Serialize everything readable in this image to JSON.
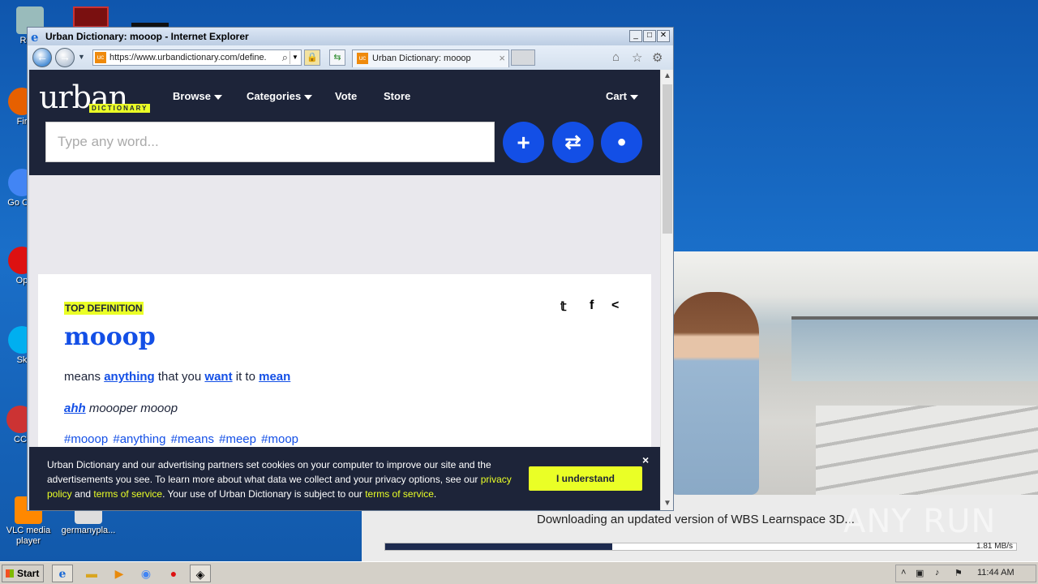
{
  "desktop": {
    "icons": [
      {
        "label": "Recy",
        "color": "#8aa"
      },
      {
        "label": "Fir",
        "color": "#e66000"
      },
      {
        "label": "Go\nChr",
        "color": "#4285f4"
      },
      {
        "label": "Op",
        "color": "#d11"
      },
      {
        "label": "Sk",
        "color": "#00aff0"
      },
      {
        "label": "CC",
        "color": "#c33"
      },
      {
        "label": "VLC media player",
        "color": "#f80"
      },
      {
        "label": "germanypla...",
        "color": "#ddd"
      }
    ]
  },
  "background_app": {
    "download_text": "Downloading an updated version of WBS Learnspace 3D...",
    "download_progress": 0.36,
    "speed": "1.81 MB/s",
    "watermark": "ANY RUN"
  },
  "browser": {
    "title": "Urban Dictionary: mooop - Internet Explorer",
    "url": "https://www.urbandictionary.com/define.",
    "tab_label": "Urban Dictionary: mooop",
    "favicon": "uc",
    "controls": {
      "minimize": "_",
      "maximize": "□",
      "close": "✕"
    }
  },
  "site": {
    "logo_word": "urban",
    "logo_sub": "DICTIONARY",
    "nav": {
      "browse": "Browse",
      "categories": "Categories",
      "vote": "Vote",
      "store": "Store",
      "cart": "Cart"
    },
    "search_placeholder": "Type any word...",
    "buttons": {
      "add": "+",
      "random": "⇄",
      "user": "●"
    }
  },
  "definition": {
    "badge": "TOP DEFINITION",
    "word": "mooop",
    "meaning_parts": [
      "means ",
      "anything",
      " that you ",
      "want",
      " it to ",
      "mean"
    ],
    "example_link": "ahh",
    "example_rest": " moooper mooop",
    "tags": "#mooop #anything #means #meep #moop"
  },
  "cookie": {
    "text_1": "Urban Dictionary and our advertising partners set cookies on your computer to improve our site and the advertisements you see. To learn more about what data we collect and your privacy options, see our ",
    "link_privacy": "privacy policy",
    "text_2": " and ",
    "link_terms": "terms of service",
    "text_3": ". Your use of Urban Dictionary is subject to our ",
    "link_terms2": "terms of service",
    "text_4": ".",
    "button": "I understand",
    "close": "×"
  },
  "taskbar": {
    "start": "Start",
    "time": "11:44 AM"
  },
  "colors": {
    "ud_navy": "#1d2439",
    "ud_blue": "#134fe6",
    "ud_yellow": "#eaff26"
  }
}
